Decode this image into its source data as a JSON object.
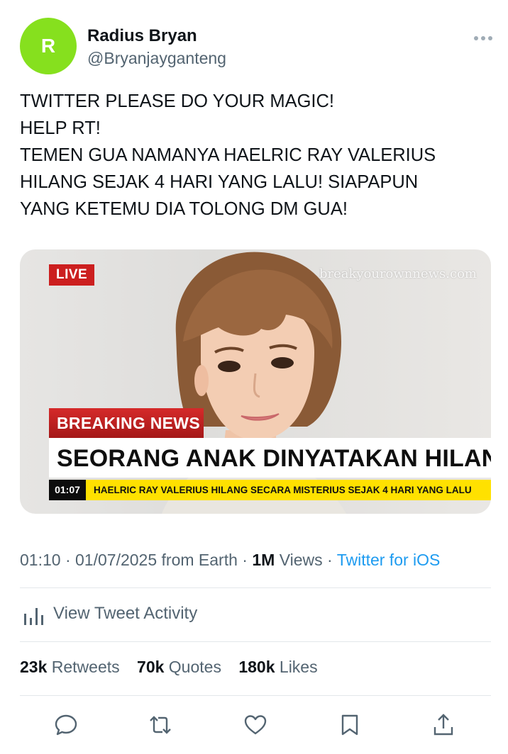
{
  "author": {
    "initial": "R",
    "name": "Radius Bryan",
    "handle": "@Bryanjayganteng",
    "avatar_color": "#86e01e"
  },
  "more_icon": "more-horizontal-icon",
  "tweet_lines": [
    "TWITTER PLEASE DO YOUR MAGIC!",
    "HELP RT!",
    "TEMEN GUA NAMANYA HAELRIC RAY VALERIUS",
    "HILANG SEJAK 4 HARI YANG LALU! SIAPAPUN",
    "YANG KETEMU DIA TOLONG DM GUA!"
  ],
  "media": {
    "live_label": "LIVE",
    "watermark": "breakyourownnews.com",
    "breaking_label": "BREAKING NEWS",
    "headline": "SEORANG ANAK DINYATAKAN HILANG",
    "ticker_time": "01:07",
    "ticker_text": "HAELRIC RAY VALERIUS HILANG SECARA MISTERIUS SEJAK 4 HARI YANG LALU"
  },
  "meta": {
    "time": "01:10",
    "date": "01/07/2025",
    "location": "from Earth",
    "views_count": "1M",
    "views_label": "Views",
    "client": "Twitter for iOS",
    "separator": "·"
  },
  "activity": {
    "label": "View Tweet Activity",
    "icon": "bar-chart-icon"
  },
  "stats": {
    "retweets_count": "23k",
    "retweets_label": "Retweets",
    "quotes_count": "70k",
    "quotes_label": "Quotes",
    "likes_count": "180k",
    "likes_label": "Likes"
  },
  "actions": [
    "reply-icon",
    "retweet-icon",
    "like-icon",
    "bookmark-icon",
    "share-icon"
  ],
  "colors": {
    "text": "#0f1419",
    "secondary": "#536471",
    "link": "#1d9bf0",
    "news_red": "#cc1f1f",
    "ticker_yellow": "#ffe100"
  }
}
